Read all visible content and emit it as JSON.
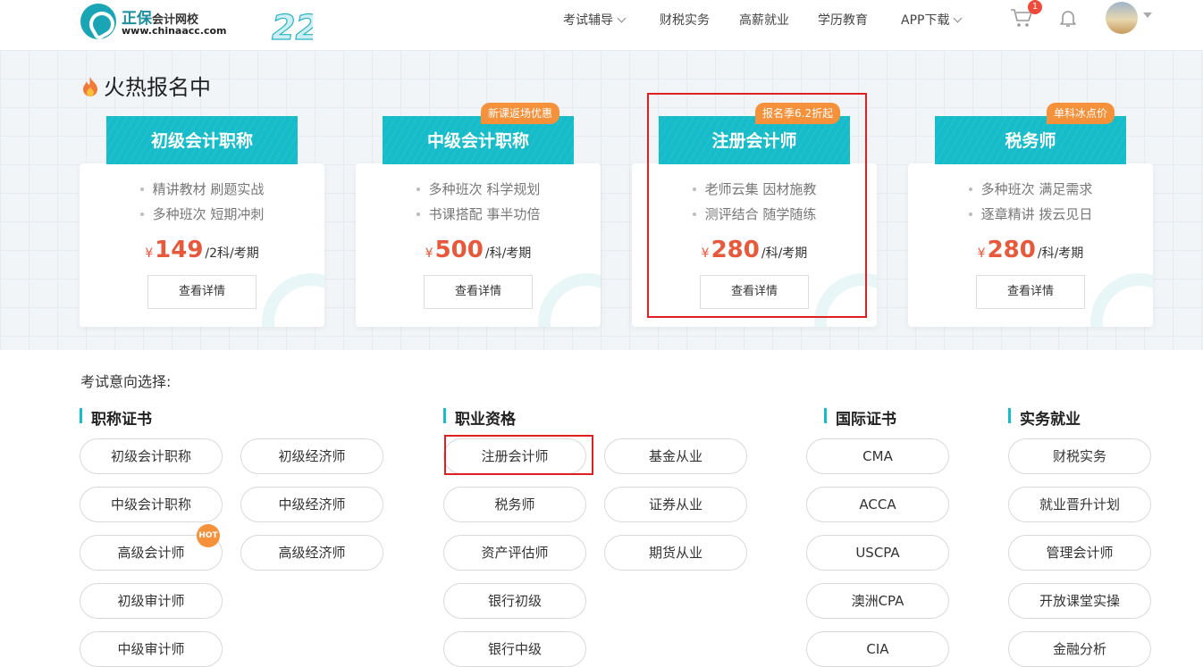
{
  "header": {
    "logo_brand": "正保",
    "logo_name": "会计网校",
    "logo_url": "www.chinaacc.com",
    "anniversary": "22",
    "nav": [
      {
        "label": "考试辅导",
        "dropdown": true
      },
      {
        "label": "财税实务",
        "dropdown": false
      },
      {
        "label": "高薪就业",
        "dropdown": false
      },
      {
        "label": "学历教育",
        "dropdown": false
      },
      {
        "label": "APP下载",
        "dropdown": true
      }
    ],
    "cart_count": "1",
    "icons": [
      "cart-icon",
      "bell-icon",
      "avatar"
    ]
  },
  "hot": {
    "title": "火热报名中",
    "cards": [
      {
        "name": "初级会计职称",
        "tag": "",
        "features": [
          "精讲教材 刷题实战",
          "多种班次 短期冲刺"
        ],
        "currency": "¥",
        "price": "149",
        "unit": "/2科/考期",
        "button": "查看详情"
      },
      {
        "name": "中级会计职称",
        "tag": "新课返场优惠",
        "features": [
          "多种班次 科学规划",
          "书课搭配 事半功倍"
        ],
        "currency": "¥",
        "price": "500",
        "unit": "/科/考期",
        "button": "查看详情"
      },
      {
        "name": "注册会计师",
        "tag": "报名季6.2折起",
        "features": [
          "老师云集 因材施教",
          "测评结合 随学随练"
        ],
        "currency": "¥",
        "price": "280",
        "unit": "/科/考期",
        "button": "查看详情"
      },
      {
        "name": "税务师",
        "tag": "单科冰点价",
        "features": [
          "多种班次 满足需求",
          "逐章精讲 拨云见日"
        ],
        "currency": "¥",
        "price": "280",
        "unit": "/科/考期",
        "button": "查看详情"
      }
    ]
  },
  "intent": {
    "label": "考试意向选择:",
    "hot_badge": "HOT",
    "categories": [
      {
        "title": "职称证书",
        "items": [
          "初级会计职称",
          "初级经济师",
          "中级会计职称",
          "中级经济师",
          "高级会计师",
          "高级经济师",
          "初级审计师",
          "中级审计师"
        ]
      },
      {
        "title": "职业资格",
        "items": [
          "注册会计师",
          "基金从业",
          "税务师",
          "证券从业",
          "资产评估师",
          "期货从业",
          "银行初级",
          "银行中级"
        ]
      },
      {
        "title": "国际证书",
        "items": [
          "CMA",
          "ACCA",
          "USCPA",
          "澳洲CPA",
          "CIA"
        ]
      },
      {
        "title": "实务就业",
        "items": [
          "财税实务",
          "就业晋升计划",
          "管理会计师",
          "开放课堂实操",
          "金融分析"
        ]
      }
    ]
  },
  "colors": {
    "accent": "#16bcc9",
    "price": "#e8583a",
    "tag": "#f5913a",
    "highlight": "#e02020"
  }
}
